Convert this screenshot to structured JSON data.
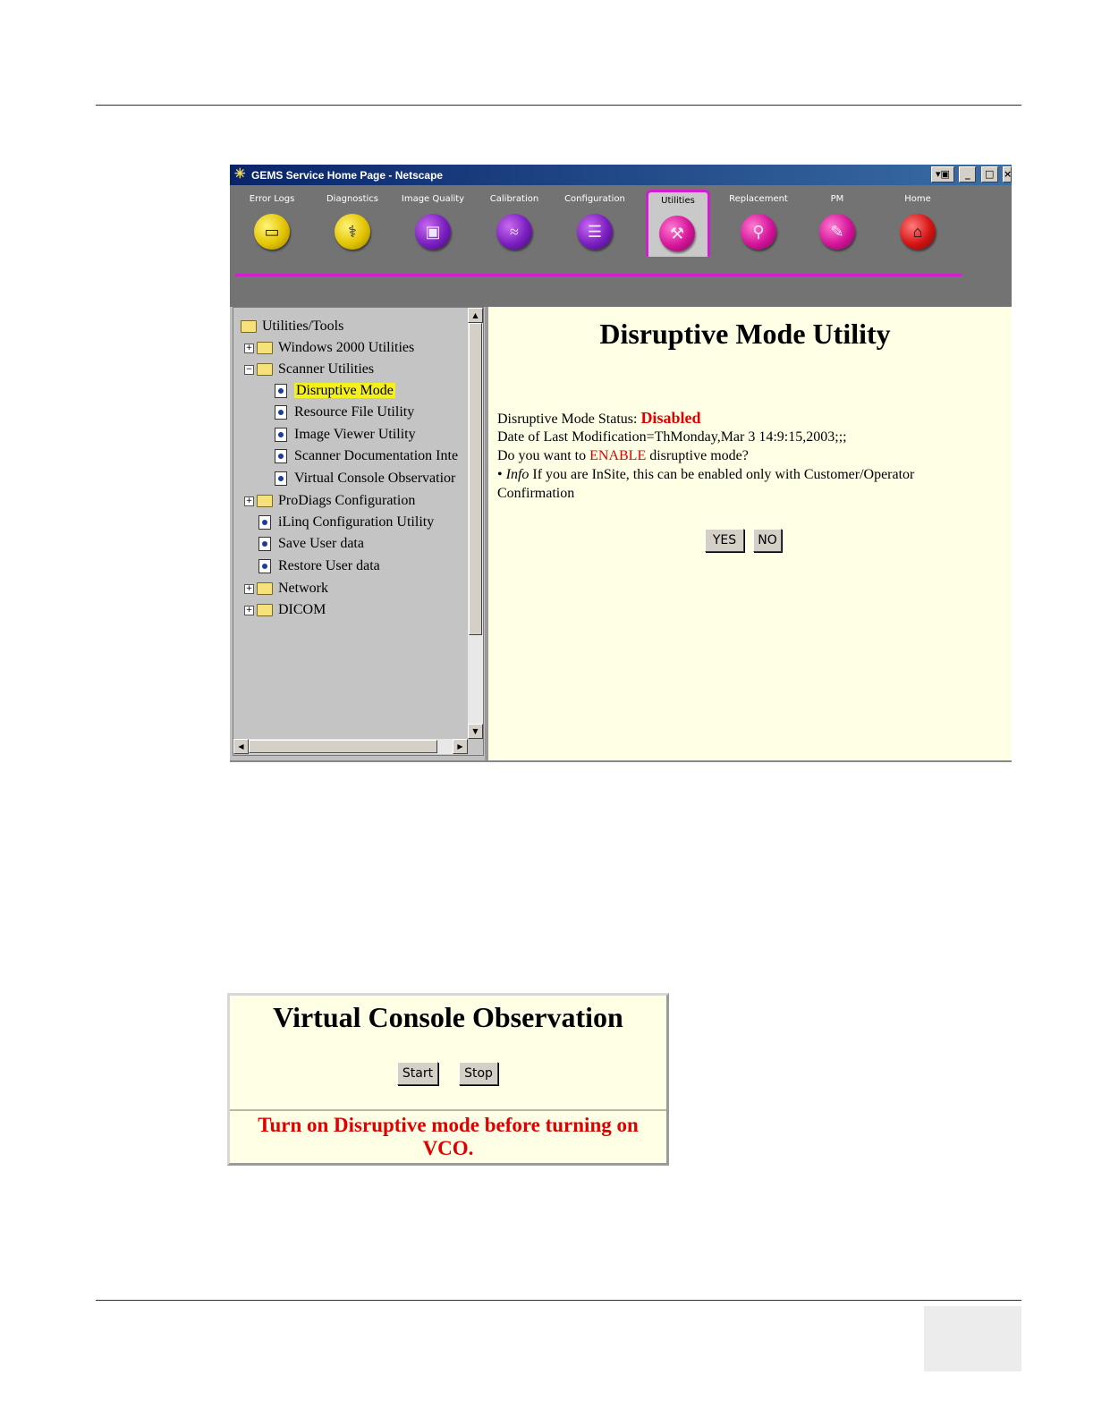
{
  "window": {
    "title": "GEMS Service Home Page - Netscape",
    "controls": [
      "▾▣",
      "_",
      "□",
      "×"
    ]
  },
  "toolbar": {
    "items": [
      {
        "label": "Error Logs",
        "icon": "error-logs-icon",
        "glyph": "▭",
        "color": "yellow"
      },
      {
        "label": "Diagnostics",
        "icon": "stethoscope-icon",
        "glyph": "⚕",
        "color": "yellow"
      },
      {
        "label": "Image Quality",
        "icon": "image-quality-icon",
        "glyph": "▣",
        "color": "purple"
      },
      {
        "label": "Calibration",
        "icon": "calibration-icon",
        "glyph": "≈",
        "color": "purple"
      },
      {
        "label": "Configuration",
        "icon": "configuration-icon",
        "glyph": "☰",
        "color": "purple"
      },
      {
        "label": "Utilities",
        "icon": "utilities-icon",
        "glyph": "⚒",
        "color": "magenta",
        "active": true
      },
      {
        "label": "Replacement",
        "icon": "replacement-icon",
        "glyph": "⚲",
        "color": "magenta"
      },
      {
        "label": "PM",
        "icon": "pm-icon",
        "glyph": "✎",
        "color": "magenta"
      },
      {
        "label": "Home",
        "icon": "home-icon",
        "glyph": "⌂",
        "color": "red"
      }
    ]
  },
  "tree": {
    "root": "Utilities/Tools",
    "windows_2000": "Windows 2000 Utilities",
    "scanner_utilities": "Scanner Utilities",
    "disruptive_mode": "Disruptive Mode",
    "resource_file": "Resource File Utility",
    "image_viewer": "Image Viewer Utility",
    "scanner_documentation": "Scanner Documentation Inte",
    "virtual_console": "Virtual Console Observatior",
    "prodiags": "ProDiags Configuration",
    "ilinq": "iLinq Configuration Utility",
    "save_user_data": "Save User data",
    "restore_user_data": "Restore User data",
    "network": "Network",
    "dicom": "DICOM"
  },
  "disruptive": {
    "heading": "Disruptive Mode Utility",
    "status_label": "Disruptive Mode Status: ",
    "status_value": "Disabled",
    "last_modification": "Date of Last Modification=ThMonday,Mar 3 14:9:15,2003;;;",
    "question_prefix": "Do you want to ",
    "question_action": "ENABLE",
    "question_suffix": " disruptive mode?",
    "info_bullet": "• ",
    "info_label": "Info",
    "info_text": " If you are InSite, this can be enabled only with Customer/Operator",
    "info_text_2": "Confirmation",
    "yes_label": "YES",
    "no_label": "NO"
  },
  "vco": {
    "heading": "Virtual Console Observation",
    "start_label": "Start",
    "stop_label": "Stop",
    "warning_line1": "Turn on Disruptive mode before turning on",
    "warning_line2": "VCO."
  }
}
